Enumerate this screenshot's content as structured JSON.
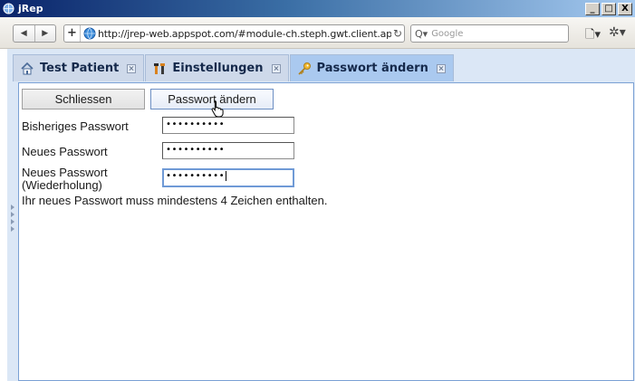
{
  "window": {
    "title": "jRep",
    "minimize": "_",
    "maximize": "□",
    "close": "X"
  },
  "browser": {
    "url": "http://jrep-web.appspot.com/#module-ch.steph.gwt.client.app.v",
    "search_placeholder": "Google",
    "new_tab": "+"
  },
  "tabs": [
    {
      "label": "Test Patient",
      "icon": "home-icon"
    },
    {
      "label": "Einstellungen",
      "icon": "tools-icon"
    },
    {
      "label": "Passwort ändern",
      "icon": "key-icon",
      "active": true
    }
  ],
  "actions": {
    "close_label": "Schliessen",
    "change_label": "Passwort ändern"
  },
  "form": {
    "old_password_label": "Bisheriges Passwort",
    "old_password_value": "••••••••••",
    "new_password_label": "Neues Passwort",
    "new_password_value": "••••••••••",
    "repeat_label_1": "Neues Passwort",
    "repeat_label_2": "(Wiederholung)",
    "repeat_value": "••••••••••",
    "hint": "Ihr neues Passwort muss mindestens 4 Zeichen enthalten."
  },
  "colors": {
    "accent": "#7aa0d4",
    "tab_active": "#aac9ef",
    "tab_inactive": "#ced9ea"
  }
}
